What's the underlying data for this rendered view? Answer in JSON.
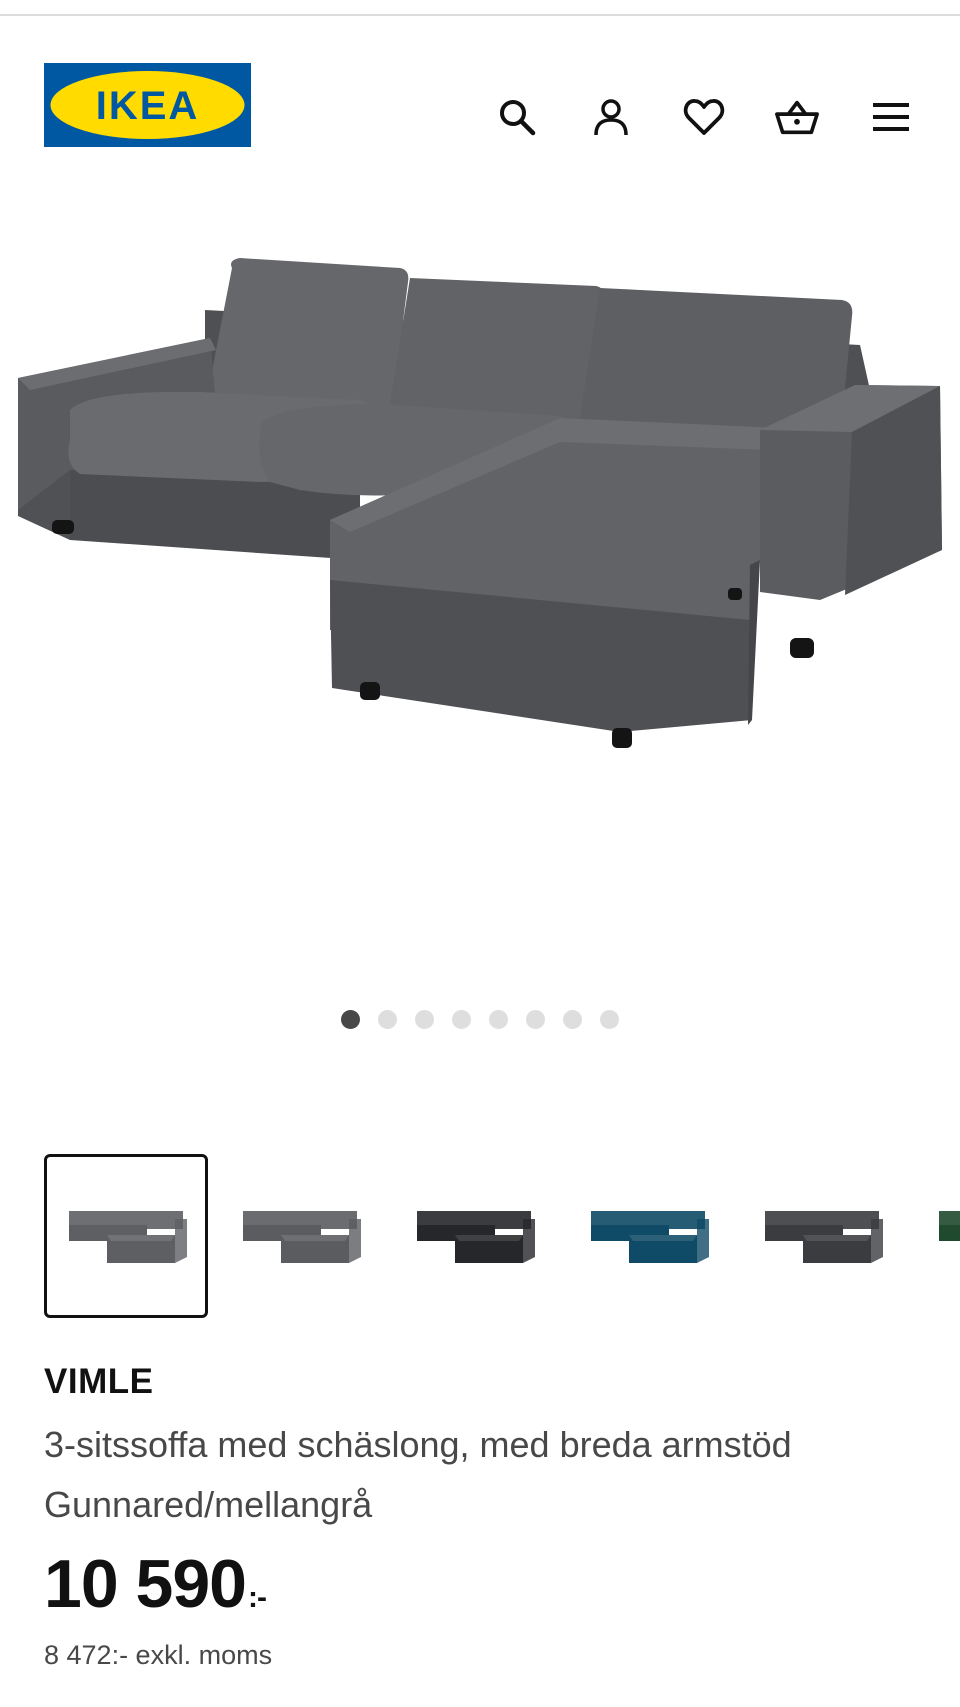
{
  "header": {
    "logo_text": "IKEA",
    "icons": [
      "search-icon",
      "account-icon",
      "heart-icon",
      "basket-icon",
      "menu-icon"
    ]
  },
  "gallery": {
    "slide_count": 8,
    "active_index": 0,
    "main_image": "sofa-with-chaise-grey",
    "thumbnails": [
      {
        "color": "#5e5f63",
        "name": "grey"
      },
      {
        "color": "#5b5c60",
        "name": "grey-headrest"
      },
      {
        "color": "#26272a",
        "name": "black"
      },
      {
        "color": "#0f4a66",
        "name": "blue"
      },
      {
        "color": "#3b3c40",
        "name": "dark-grey"
      },
      {
        "color": "#1f4a2e",
        "name": "green"
      }
    ]
  },
  "product": {
    "name": "VIMLE",
    "description": "3-sitssoffa med schäslong, med breda armstöd",
    "variant": "Gunnared/mellangrå",
    "price": "10 590",
    "price_suffix": ":-",
    "price_excl_vat": "8 472:- exkl. moms"
  },
  "colors": {
    "sofa": "#5d5e62",
    "ikea_blue": "#0058a3",
    "ikea_yellow": "#ffdb00"
  }
}
